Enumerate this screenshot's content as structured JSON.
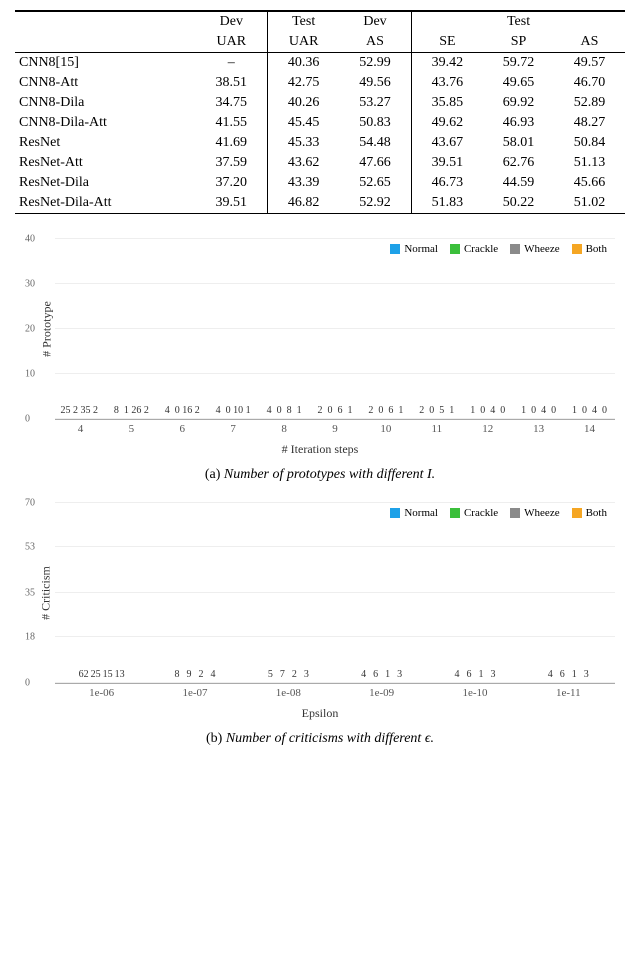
{
  "table": {
    "header1": [
      "",
      "Dev",
      "Test",
      "Dev",
      "",
      "Test",
      ""
    ],
    "header2": [
      "",
      "UAR",
      "UAR",
      "AS",
      "SE",
      "SP",
      "AS"
    ],
    "rows": [
      {
        "name": "CNN8[15]",
        "devuar": "–",
        "testuar": "40.36",
        "devas": "52.99",
        "se": "39.42",
        "sp": "59.72",
        "as": "49.57"
      },
      {
        "name": "CNN8-Att",
        "devuar": "38.51",
        "testuar": "42.75",
        "devas": "49.56",
        "se": "43.76",
        "sp": "49.65",
        "as": "46.70"
      },
      {
        "name": "CNN8-Dila",
        "devuar": "34.75",
        "testuar": "40.26",
        "devas": "53.27",
        "se": "35.85",
        "sp": "69.92",
        "as": "52.89",
        "bold_as": true
      },
      {
        "name": "CNN8-Dila-Att",
        "devuar": "41.55",
        "testuar": "45.45",
        "devas": "50.83",
        "se": "49.62",
        "sp": "46.93",
        "as": "48.27"
      },
      {
        "name": "ResNet",
        "devuar": "41.69",
        "testuar": "45.33",
        "devas": "54.48",
        "se": "43.67",
        "sp": "58.01",
        "as": "50.84"
      },
      {
        "name": "ResNet-Att",
        "devuar": "37.59",
        "testuar": "43.62",
        "devas": "47.66",
        "se": "39.51",
        "sp": "62.76",
        "as": "51.13"
      },
      {
        "name": "ResNet-Dila",
        "devuar": "37.20",
        "testuar": "43.39",
        "devas": "52.65",
        "se": "46.73",
        "sp": "44.59",
        "as": "45.66"
      },
      {
        "name": "ResNet-Dila-Att",
        "devuar": "39.51",
        "testuar": "46.82",
        "devas": "52.92",
        "se": "51.83",
        "sp": "50.22",
        "as": "51.02",
        "bold_testuar": true
      }
    ]
  },
  "chart_data": [
    {
      "type": "bar",
      "title": "",
      "ylabel": "# Prototype",
      "xlabel": "# Iteration steps",
      "ylim": [
        0,
        40
      ],
      "yticks": [
        0,
        10,
        20,
        30,
        40
      ],
      "categories": [
        "4",
        "5",
        "6",
        "7",
        "8",
        "9",
        "10",
        "11",
        "12",
        "13",
        "14"
      ],
      "series": [
        {
          "name": "Normal",
          "color": "c-normal",
          "values": [
            25,
            8,
            4,
            4,
            4,
            2,
            2,
            2,
            1,
            1,
            1
          ]
        },
        {
          "name": "Crackle",
          "color": "c-crackle",
          "values": [
            2,
            1,
            0,
            0,
            0,
            0,
            0,
            0,
            0,
            0,
            0
          ]
        },
        {
          "name": "Wheeze",
          "color": "c-wheeze",
          "values": [
            35,
            26,
            16,
            10,
            8,
            6,
            6,
            5,
            4,
            4,
            4
          ]
        },
        {
          "name": "Both",
          "color": "c-both",
          "values": [
            2,
            2,
            2,
            1,
            1,
            1,
            1,
            1,
            0,
            0,
            0
          ]
        }
      ],
      "caption_letter": "(a)",
      "caption_text": "Number of prototypes with different I."
    },
    {
      "type": "bar",
      "title": "",
      "ylabel": "# Criticism",
      "xlabel": "Epsilon",
      "ylim": [
        0,
        70
      ],
      "yticks": [
        0,
        18,
        35,
        53,
        70
      ],
      "categories": [
        "1e-06",
        "1e-07",
        "1e-08",
        "1e-09",
        "1e-10",
        "1e-11"
      ],
      "series": [
        {
          "name": "Normal",
          "color": "c-normal",
          "values": [
            62,
            8,
            5,
            4,
            4,
            4
          ]
        },
        {
          "name": "Crackle",
          "color": "c-crackle",
          "values": [
            25,
            9,
            7,
            6,
            6,
            6
          ]
        },
        {
          "name": "Wheeze",
          "color": "c-wheeze",
          "values": [
            15,
            2,
            2,
            1,
            1,
            1
          ]
        },
        {
          "name": "Both",
          "color": "c-both",
          "values": [
            13,
            4,
            3,
            3,
            3,
            3
          ]
        }
      ],
      "caption_letter": "(b)",
      "caption_text": "Number of criticisms with different ϵ."
    }
  ]
}
